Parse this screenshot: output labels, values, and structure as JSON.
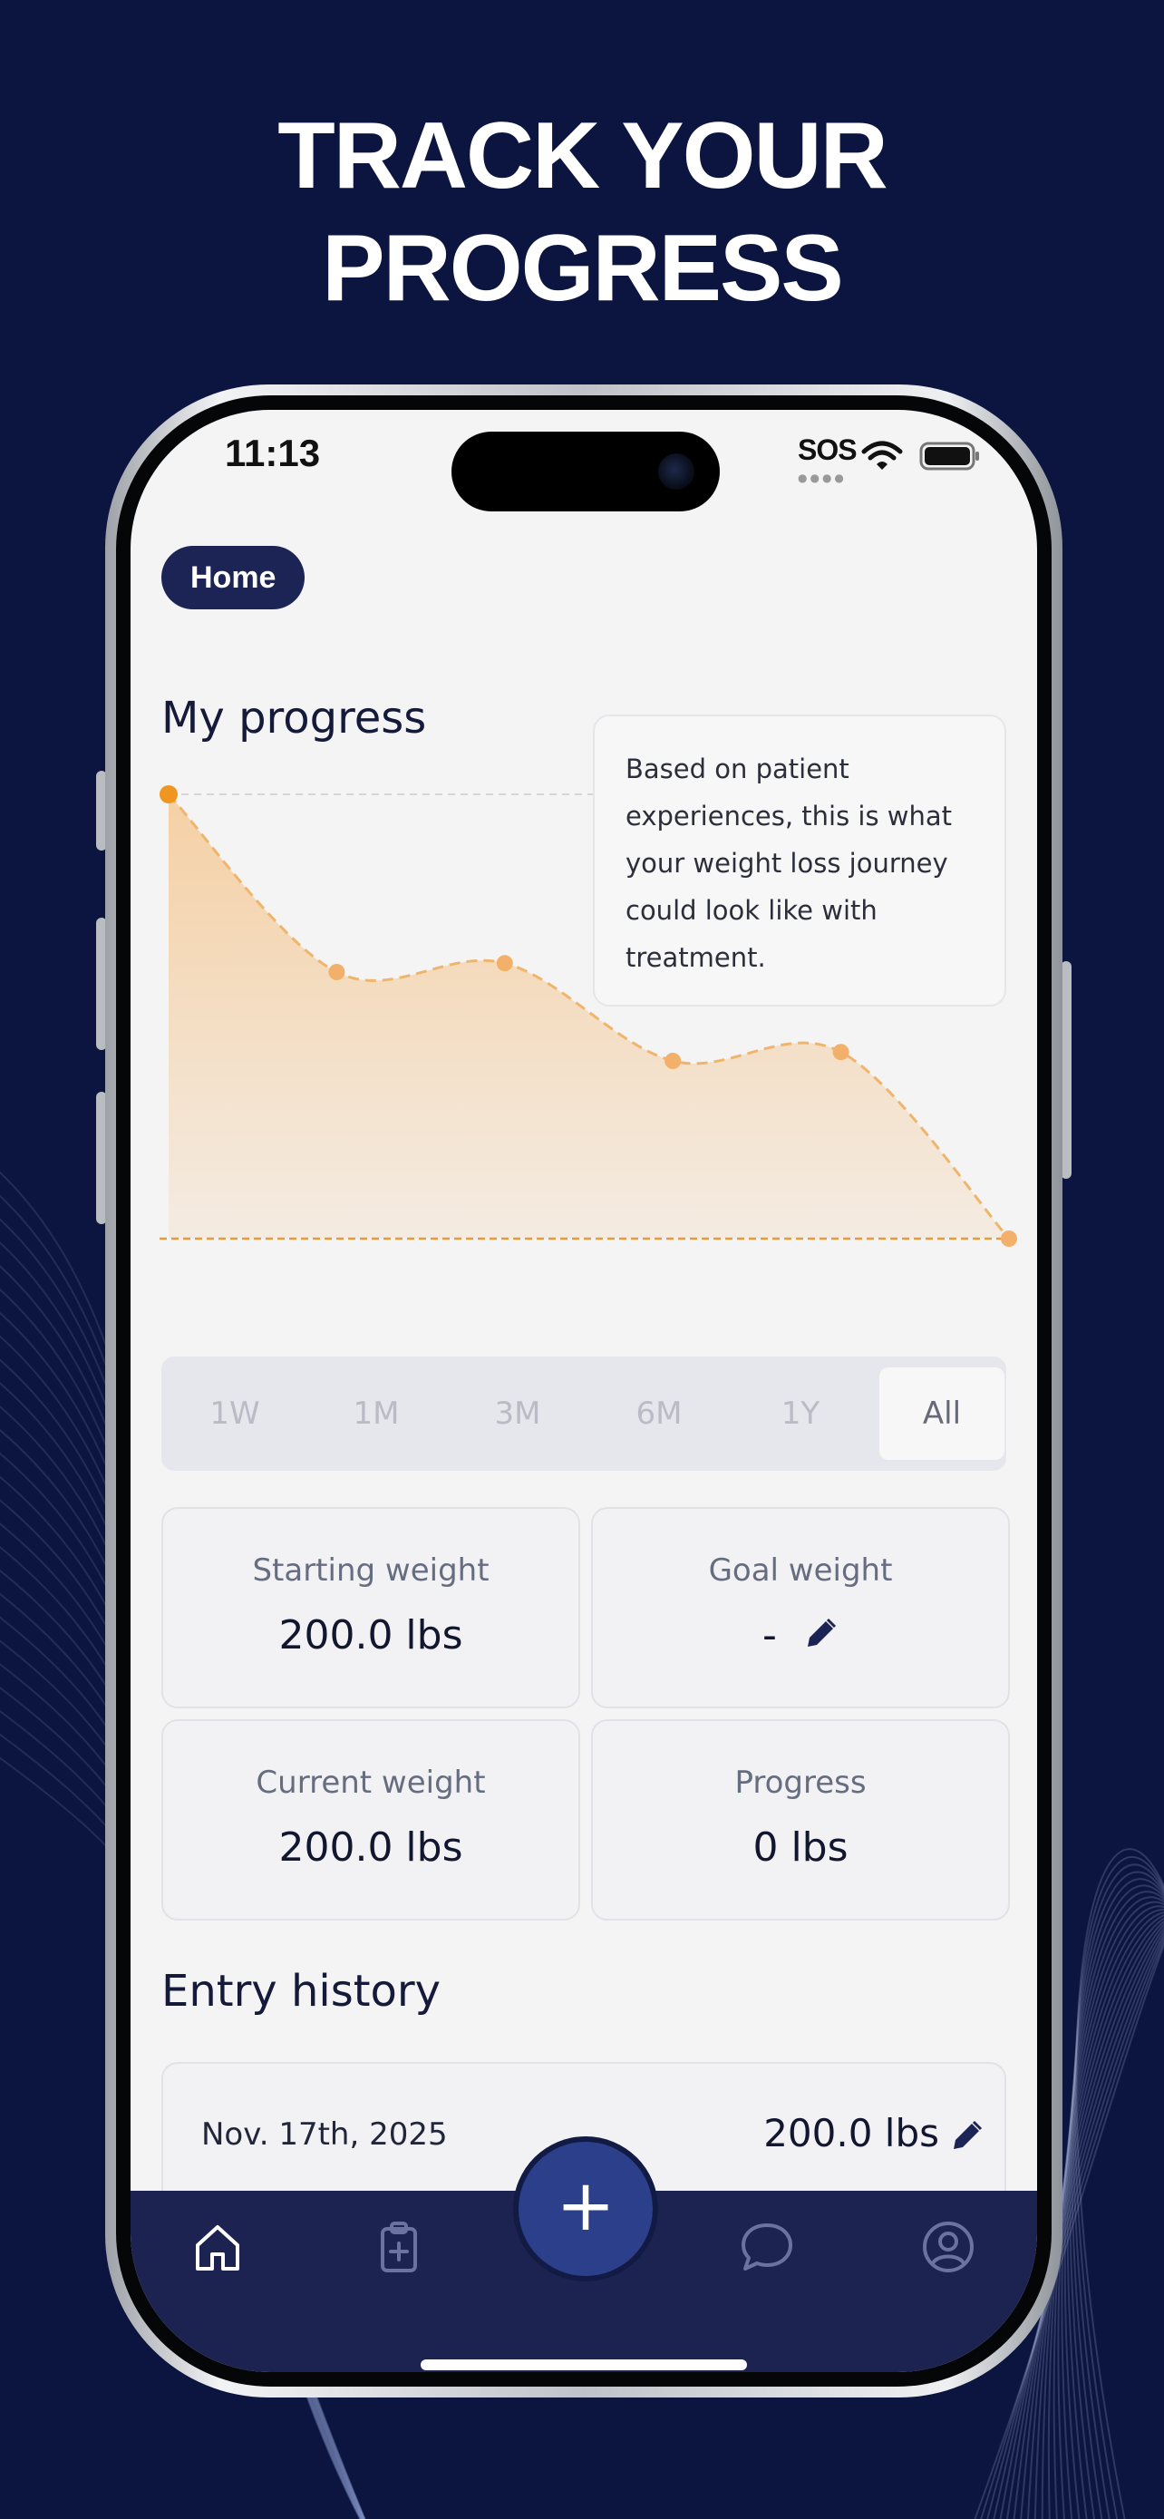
{
  "headline": {
    "line1": "TRACK YOUR",
    "line2": "PROGRESS"
  },
  "status_bar": {
    "time": "11:13",
    "sos": "SOS",
    "icons": [
      "wifi-icon",
      "battery-icon"
    ]
  },
  "nav": {
    "home_pill": "Home"
  },
  "progress": {
    "title": "My progress",
    "tooltip": [
      "Based on patient",
      "experiences, this is what",
      "your weight loss journey",
      "could look like with",
      "treatment."
    ],
    "ranges": [
      "1W",
      "1M",
      "3M",
      "6M",
      "1Y",
      "All"
    ],
    "selected_range": "All"
  },
  "chart_data": {
    "type": "area",
    "title": "",
    "xlabel": "",
    "ylabel": "",
    "x": [
      0,
      1,
      2,
      3,
      4,
      5
    ],
    "values": [
      100,
      60,
      62,
      40,
      42,
      0
    ],
    "ylim": [
      0,
      100
    ],
    "grid": false,
    "colors": {
      "fill": "#f5c48a",
      "line": "#f0b56c",
      "point": "#f2b06a",
      "first_point": "#ee961f",
      "baseline": "#e99a3a"
    }
  },
  "stats": [
    {
      "label": "Starting weight",
      "value": "200.0 lbs"
    },
    {
      "label": "Goal weight",
      "value": "-",
      "icon": "pencil-icon"
    },
    {
      "label": "Current weight",
      "value": "200.0 lbs"
    },
    {
      "label": "Progress",
      "value": "0 lbs"
    }
  ],
  "history": {
    "title": "Entry history",
    "entries": [
      {
        "date": "Nov. 17th, 2025",
        "value": "200.0 lbs",
        "icon": "pencil-icon"
      }
    ]
  },
  "tab_bar": {
    "items": [
      "home-icon",
      "clipboard-plus-icon",
      "add-icon",
      "chat-icon",
      "profile-icon"
    ],
    "fab_symbol": "+"
  },
  "colors": {
    "background": "#0c1540",
    "accent": "#1b2454",
    "fab": "#2c3f8a",
    "tabbar": "#1c2350"
  }
}
